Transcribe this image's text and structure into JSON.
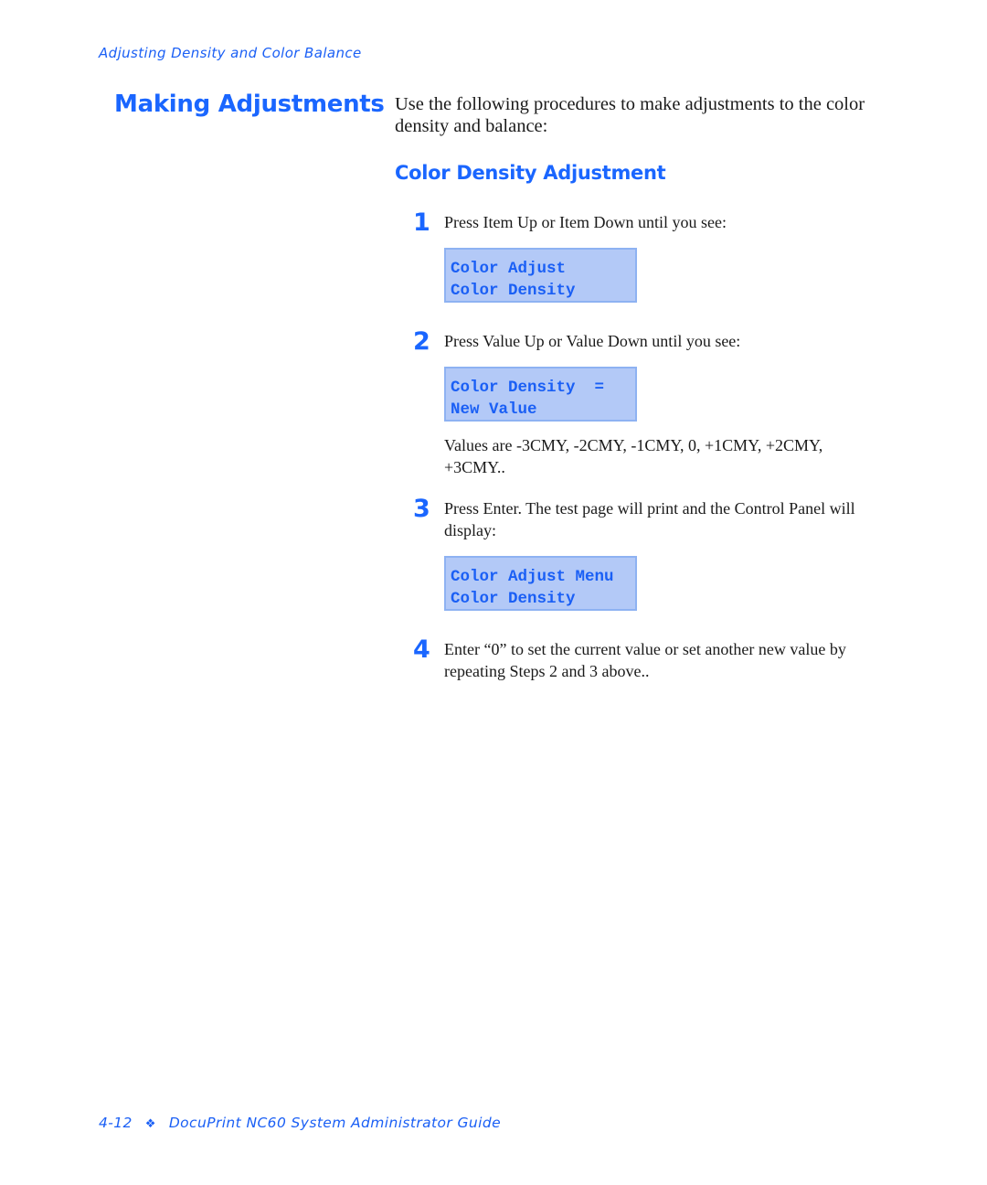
{
  "header": {
    "running_title": "Adjusting Density and Color Balance"
  },
  "section": {
    "title": "Making Adjustments",
    "intro": "Use the following procedures to make adjustments to the color density and balance:"
  },
  "subsection": {
    "title": "Color Density Adjustment"
  },
  "steps": [
    {
      "number": "1",
      "text": "Press Item Up or Item Down until you see:",
      "lcd": [
        "Color Adjust",
        "Color Density"
      ]
    },
    {
      "number": "2",
      "text": "Press Value Up or Value Down until you see:",
      "lcd": [
        "Color Density  =",
        "New Value"
      ],
      "note": "Values are -3CMY, -2CMY, -1CMY, 0, +1CMY, +2CMY, +3CMY.."
    },
    {
      "number": "3",
      "text": "Press Enter. The test page will print and the Control Panel will display:",
      "lcd": [
        "Color Adjust Menu",
        "Color Density"
      ]
    },
    {
      "number": "4",
      "text": "Enter “0” to set the current value or set another new value by repeating Steps 2 and 3 above.."
    }
  ],
  "footer": {
    "page_number": "4-12",
    "separator_icon": "diamond-ornament-icon",
    "separator_glyph": "❖",
    "guide_title": "DocuPrint NC60 System Administrator Guide"
  },
  "colors": {
    "accent_blue": "#1a66ff",
    "lcd_background": "#b3c9f7",
    "lcd_border": "#8eb2f2",
    "body_text": "#1a1a1a"
  }
}
